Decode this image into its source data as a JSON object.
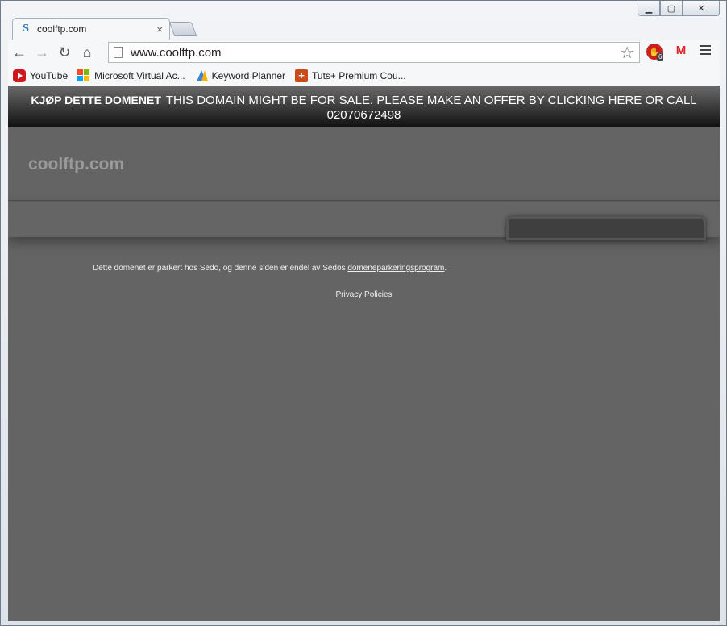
{
  "browser": {
    "tab": {
      "title": "coolftp.com",
      "favicon_letter": "S",
      "close_glyph": "×"
    },
    "window_controls": {
      "minimize": "▁",
      "maximize": "▢",
      "close": "✕"
    },
    "address_bar": {
      "url": "www.coolftp.com"
    },
    "extensions": {
      "adblock_badge": "6",
      "adblock_glyph": "✋",
      "gmail_glyph": "M"
    },
    "nav": {
      "back": "←",
      "forward": "→",
      "reload": "↻",
      "home": "⌂",
      "star": "☆"
    },
    "bookmarks": [
      {
        "label": "YouTube",
        "icon": "youtube-icon"
      },
      {
        "label": "Microsoft Virtual Ac...",
        "icon": "microsoft-icon"
      },
      {
        "label": "Keyword Planner",
        "icon": "adwords-icon"
      },
      {
        "label": "Tuts+ Premium Cou...",
        "icon": "tuts-icon",
        "glyph": "+"
      }
    ]
  },
  "page": {
    "banner": {
      "lead": "KJØP DETTE DOMENET",
      "text": "THIS DOMAIN MIGHT BE FOR SALE. PLEASE MAKE AN OFFER BY CLICKING HERE OR CALL",
      "phone": "02070672498"
    },
    "logo": "coolftp.com",
    "footer": {
      "note": "Dette domenet er parkert hos Sedo, og denne siden er endel av Sedos ",
      "note_link": "domeneparkeringsprogram",
      "note_end": ".",
      "privacy": "Privacy Policies"
    }
  },
  "colors": {
    "page_background": "#646464",
    "banner_top": "#6a6a6a",
    "banner_bottom": "#101010",
    "logo_text": "#9a9a9a"
  }
}
